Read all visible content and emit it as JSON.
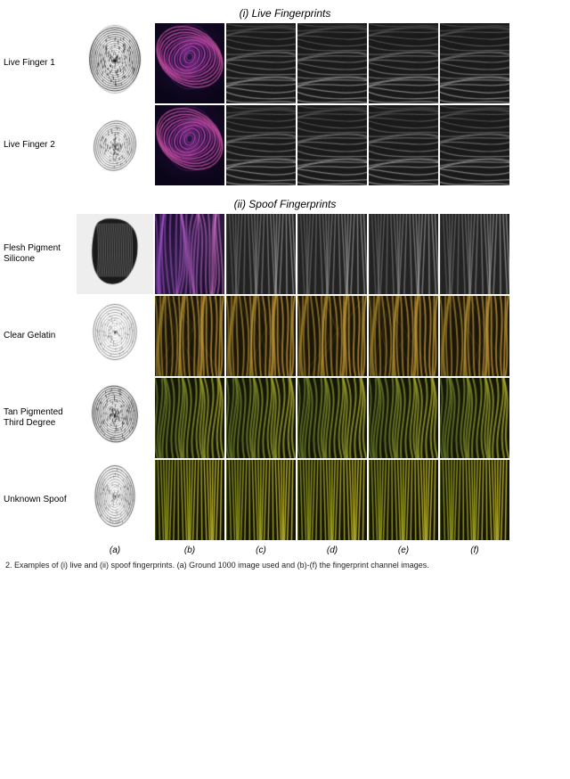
{
  "title": "",
  "sections": {
    "live": {
      "title": "(i) Live Fingerprints",
      "rows": [
        {
          "label": "Live Finger 1",
          "cells": [
            "bw_oval_fine",
            "purple_swirl",
            "grey_ridge_a",
            "grey_ridge_b",
            "grey_ridge_c",
            "grey_ridge_d"
          ]
        },
        {
          "label": "Live Finger 2",
          "cells": [
            "bw_oval_med",
            "purple_swirl2",
            "grey_ridge_e",
            "grey_ridge_f",
            "grey_ridge_g",
            "grey_ridge_h"
          ]
        }
      ]
    },
    "spoof": {
      "title": "(ii) Spoof Fingerprints",
      "rows": [
        {
          "label": "Flesh Pigment Silicone",
          "cells": [
            "bw_blob",
            "purple_wide",
            "grey_spoof_a",
            "grey_spoof_b",
            "grey_spoof_c",
            "grey_spoof_d"
          ]
        },
        {
          "label": "Clear Gelatin",
          "cells": [
            "bw_oval_light",
            "yellow_ridge",
            "yellow_ridge2",
            "yellow_ridge3",
            "yellow_ridge4",
            "yellow_ridge5"
          ]
        },
        {
          "label": "Tan Pigmented Third Degree",
          "cells": [
            "bw_oval_dark2",
            "olive_ridge",
            "olive_ridge2",
            "olive_ridge3",
            "olive_ridge4",
            "olive_ridge5"
          ]
        },
        {
          "label": "Unknown Spoof",
          "cells": [
            "bw_oval_thin",
            "olive_yellow",
            "olive_yellow2",
            "olive_yellow3",
            "olive_yellow4",
            "olive_yellow5"
          ]
        }
      ]
    }
  },
  "col_labels": [
    "(a)",
    "(b)",
    "(c)",
    "(d)",
    "(e)",
    "(f)"
  ],
  "caption": "2. Examples of (i) live and (ii) spoof fingerprints. (a) Ground 1000 image used and (b)-(f) the fingerprint channel images."
}
